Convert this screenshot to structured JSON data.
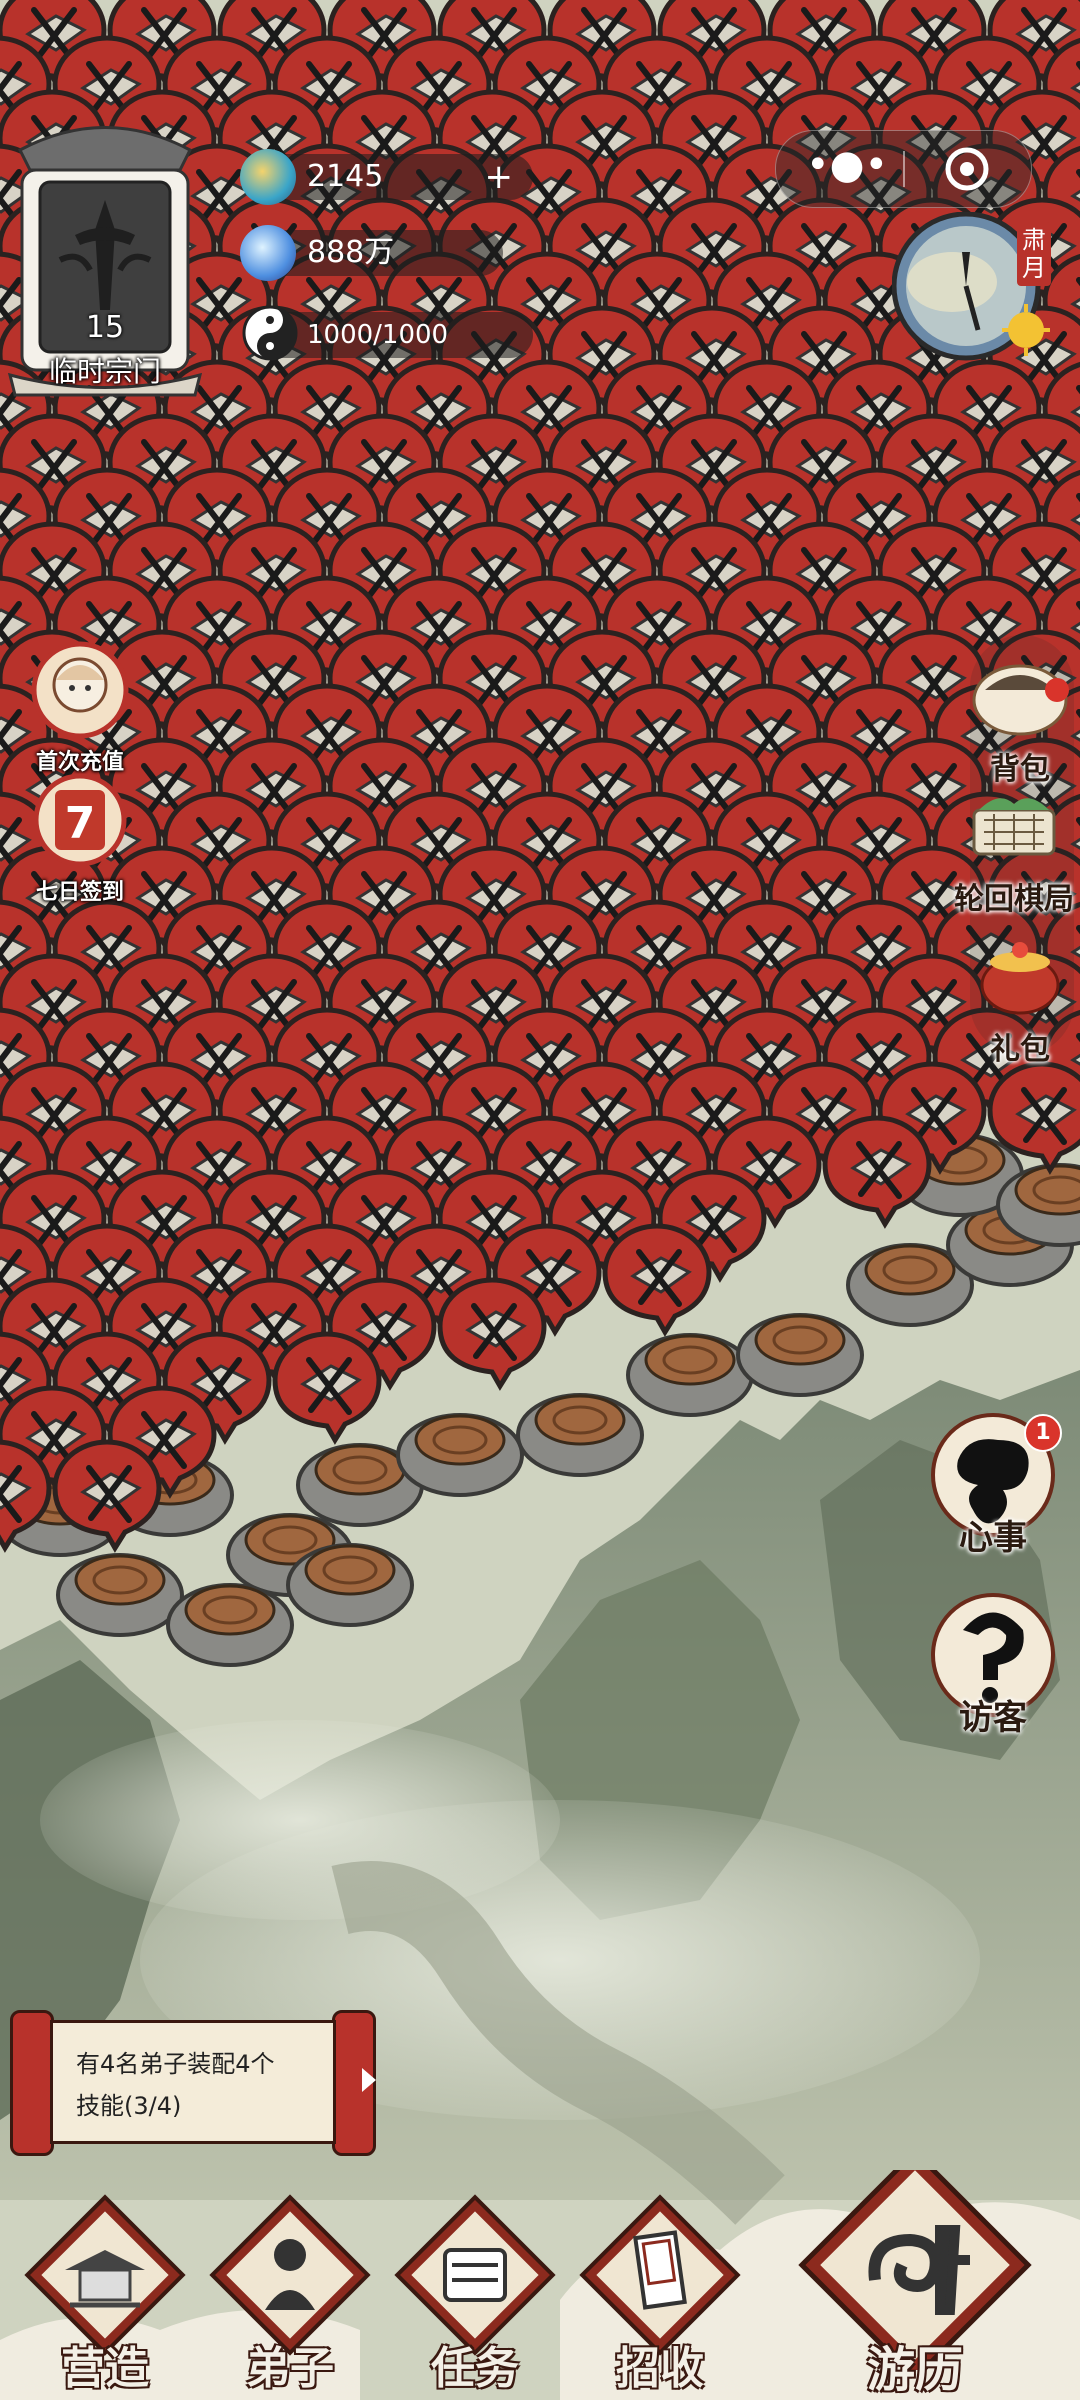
{
  "sect": {
    "level": "15",
    "name": "临时宗门"
  },
  "resources": {
    "spirit_stone": "2145",
    "plus": "+",
    "crystal": "888万",
    "taiji": "1000/1000"
  },
  "season": {
    "label": "肃月"
  },
  "left_buttons": [
    {
      "label": "首次充值"
    },
    {
      "label": "七日签到"
    }
  ],
  "right_buttons": [
    {
      "label": "背包"
    },
    {
      "label": "轮回棋局"
    },
    {
      "label": "礼包"
    }
  ],
  "right_lower_buttons": [
    {
      "label": "心事",
      "badge": "1"
    },
    {
      "label": "访客"
    }
  ],
  "quest_scroll": {
    "text_line1": "有4名弟子装配4个",
    "text_line2": "技能(3/4)"
  },
  "bottom_nav": [
    {
      "label": "营造"
    },
    {
      "label": "弟子"
    },
    {
      "label": "任务"
    },
    {
      "label": "招收"
    },
    {
      "label": "游历"
    }
  ],
  "colors": {
    "marker_red": "#b8322b",
    "marker_dark": "#2b2220",
    "nav_red": "#8c2a1e",
    "ink_bg": "#cfd3c0"
  },
  "icons": {
    "spirit_stone": "spirit-stone-icon",
    "crystal": "crystal-icon",
    "taiji": "taiji-icon",
    "more": "more-dots-icon",
    "close": "target-close-icon"
  }
}
